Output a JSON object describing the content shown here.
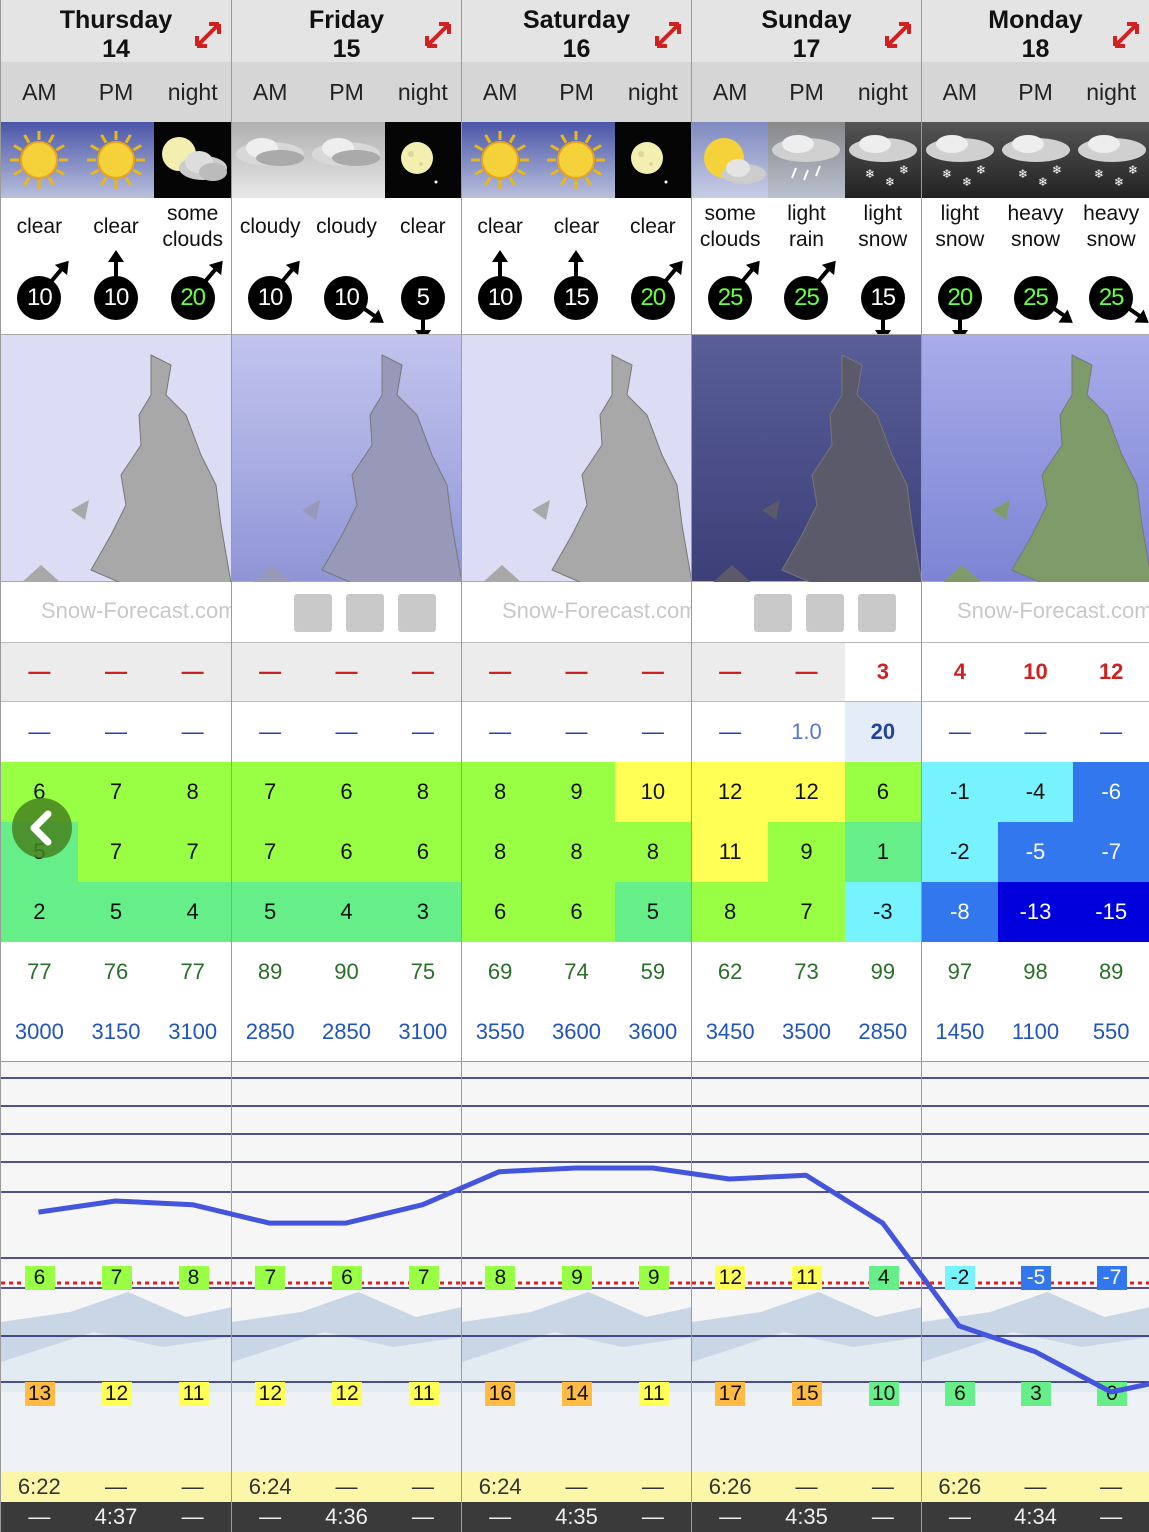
{
  "slot_labels": [
    "AM",
    "PM",
    "night"
  ],
  "brand_text": "Snow-Forecast.com",
  "days": [
    {
      "name": "Thursday",
      "date": "14",
      "icons": [
        "sun-icon",
        "sun-icon",
        "moon-cloud-icon"
      ],
      "weather": [
        "clear",
        "clear",
        "some clouds"
      ],
      "wind": [
        {
          "speed": "10",
          "dir": "ne",
          "green": false
        },
        {
          "speed": "10",
          "dir": "n",
          "green": false
        },
        {
          "speed": "20",
          "dir": "ne",
          "green": true
        }
      ],
      "snow": [
        "—",
        "—",
        "—"
      ],
      "rain": [
        "—",
        "—",
        "—"
      ],
      "tmax": [
        "6",
        "7",
        "8"
      ],
      "tmin": [
        "5",
        "7",
        "7"
      ],
      "chill": [
        "2",
        "5",
        "4"
      ],
      "humidity": [
        "77",
        "76",
        "77"
      ],
      "freeze": [
        "3000",
        "3150",
        "3100"
      ],
      "top_temp": [
        "6",
        "7",
        "8"
      ],
      "bot_temp": [
        "13",
        "12",
        "11"
      ],
      "sunrise": "6:22",
      "sunset": "4:37"
    },
    {
      "name": "Friday",
      "date": "15",
      "icons": [
        "cloud-icon",
        "cloud-icon",
        "moon-icon"
      ],
      "weather": [
        "cloudy",
        "cloudy",
        "clear"
      ],
      "wind": [
        {
          "speed": "10",
          "dir": "ne",
          "green": false
        },
        {
          "speed": "10",
          "dir": "se",
          "green": false
        },
        {
          "speed": "5",
          "dir": "s",
          "green": false
        }
      ],
      "snow": [
        "—",
        "—",
        "—"
      ],
      "rain": [
        "—",
        "—",
        "—"
      ],
      "tmax": [
        "7",
        "6",
        "8"
      ],
      "tmin": [
        "7",
        "6",
        "6"
      ],
      "chill": [
        "5",
        "4",
        "3"
      ],
      "humidity": [
        "89",
        "90",
        "75"
      ],
      "freeze": [
        "2850",
        "2850",
        "3100"
      ],
      "top_temp": [
        "7",
        "6",
        "7"
      ],
      "bot_temp": [
        "12",
        "12",
        "11"
      ],
      "sunrise": "6:24",
      "sunset": "4:36"
    },
    {
      "name": "Saturday",
      "date": "16",
      "icons": [
        "sun-icon",
        "sun-icon",
        "moon-icon"
      ],
      "weather": [
        "clear",
        "clear",
        "clear"
      ],
      "wind": [
        {
          "speed": "10",
          "dir": "n",
          "green": false
        },
        {
          "speed": "15",
          "dir": "n",
          "green": false
        },
        {
          "speed": "20",
          "dir": "ne",
          "green": true
        }
      ],
      "snow": [
        "—",
        "—",
        "—"
      ],
      "rain": [
        "—",
        "—",
        "—"
      ],
      "tmax": [
        "8",
        "9",
        "10"
      ],
      "tmin": [
        "8",
        "8",
        "8"
      ],
      "chill": [
        "6",
        "6",
        "5"
      ],
      "humidity": [
        "69",
        "74",
        "59"
      ],
      "freeze": [
        "3550",
        "3600",
        "3600"
      ],
      "top_temp": [
        "8",
        "9",
        "9"
      ],
      "bot_temp": [
        "16",
        "14",
        "11"
      ],
      "sunrise": "6:24",
      "sunset": "4:35"
    },
    {
      "name": "Sunday",
      "date": "17",
      "icons": [
        "sun-cloud-icon",
        "rain-cloud-icon",
        "snow-cloud-icon"
      ],
      "weather": [
        "some clouds",
        "light rain",
        "light snow"
      ],
      "wind": [
        {
          "speed": "25",
          "dir": "ne",
          "green": true
        },
        {
          "speed": "25",
          "dir": "ne",
          "green": true
        },
        {
          "speed": "15",
          "dir": "s",
          "green": false
        }
      ],
      "snow": [
        "—",
        "—",
        "3"
      ],
      "rain": [
        "—",
        "1.0",
        "20"
      ],
      "tmax": [
        "12",
        "12",
        "6"
      ],
      "tmin": [
        "11",
        "9",
        "1"
      ],
      "chill": [
        "8",
        "7",
        "-3"
      ],
      "humidity": [
        "62",
        "73",
        "99"
      ],
      "freeze": [
        "3450",
        "3500",
        "2850"
      ],
      "top_temp": [
        "12",
        "11",
        "4"
      ],
      "bot_temp": [
        "17",
        "15",
        "10"
      ],
      "sunrise": "6:26",
      "sunset": "4:35"
    },
    {
      "name": "Monday",
      "date": "18",
      "icons": [
        "snow-cloud-icon",
        "snow-cloud-icon",
        "snow-cloud-icon"
      ],
      "weather": [
        "light snow",
        "heavy snow",
        "heavy snow"
      ],
      "wind": [
        {
          "speed": "20",
          "dir": "s",
          "green": true
        },
        {
          "speed": "25",
          "dir": "se",
          "green": true
        },
        {
          "speed": "25",
          "dir": "se",
          "green": true
        }
      ],
      "snow": [
        "4",
        "10",
        "12"
      ],
      "rain": [
        "—",
        "—",
        "—"
      ],
      "tmax": [
        "-1",
        "-4",
        "-6"
      ],
      "tmin": [
        "-2",
        "-5",
        "-7"
      ],
      "chill": [
        "-8",
        "-13",
        "-15"
      ],
      "humidity": [
        "97",
        "98",
        "89"
      ],
      "freeze": [
        "1450",
        "1100",
        "550"
      ],
      "top_temp": [
        "-2",
        "-5",
        "-7"
      ],
      "bot_temp": [
        "6",
        "3",
        "0"
      ],
      "sunrise": "6:26",
      "sunset": "4:34"
    }
  ],
  "dash": "—",
  "colors": {
    "green": "#99ff44",
    "lightgreen": "#66ee88",
    "yellow": "#ffff55",
    "orange": "#ffbb44",
    "cyan": "#77f3ff",
    "blue": "#3377ee",
    "darkblue": "#0000dd",
    "line": "#4455dd"
  }
}
